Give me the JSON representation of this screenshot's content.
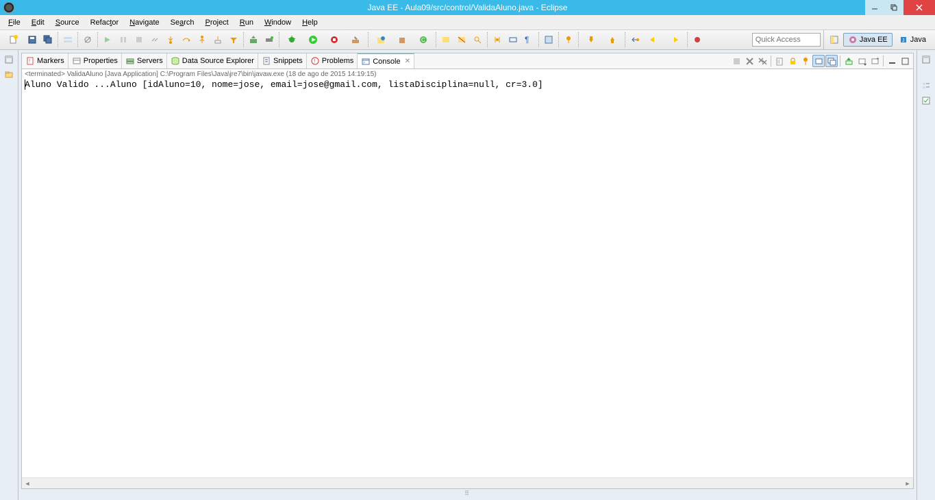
{
  "title": "Java EE - Aula09/src/control/ValidaAluno.java - Eclipse",
  "menu": [
    "File",
    "Edit",
    "Source",
    "Refactor",
    "Navigate",
    "Search",
    "Project",
    "Run",
    "Window",
    "Help"
  ],
  "quick_access_placeholder": "Quick Access",
  "perspectives": [
    {
      "label": "Java EE",
      "active": true
    },
    {
      "label": "Java",
      "active": false
    }
  ],
  "views": {
    "tabs": [
      {
        "label": "Markers",
        "icon": "markers"
      },
      {
        "label": "Properties",
        "icon": "properties"
      },
      {
        "label": "Servers",
        "icon": "servers"
      },
      {
        "label": "Data Source Explorer",
        "icon": "datasource"
      },
      {
        "label": "Snippets",
        "icon": "snippets"
      },
      {
        "label": "Problems",
        "icon": "problems"
      },
      {
        "label": "Console",
        "icon": "console",
        "active": true
      }
    ]
  },
  "console": {
    "status": "<terminated> ValidaAluno [Java Application] C:\\Program Files\\Java\\jre7\\bin\\javaw.exe (18 de ago de 2015 14:19:15)",
    "output": "Aluno Valido ...Aluno [idAluno=10, nome=jose, email=jose@gmail.com, listaDisciplina=null, cr=3.0]"
  }
}
